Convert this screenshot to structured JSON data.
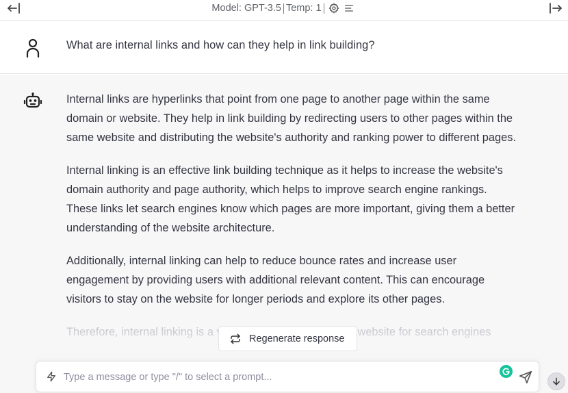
{
  "topbar": {
    "model_label": "Model: GPT-3.5",
    "temp_label": "Temp: 1",
    "icons": [
      "arrow-left-bar-icon",
      "gear-icon",
      "menu-icon",
      "arrow-right-bar-icon"
    ]
  },
  "user_message": {
    "text": "What are internal links and how can they help in link building?",
    "avatar_icon": "user-icon"
  },
  "assistant_message": {
    "avatar_icon": "robot-icon",
    "paragraphs": [
      "Internal links are hyperlinks that point from one page to another page within the same domain or website. They help in link building by redirecting users to other pages within the same website and distributing the website's authority and ranking power to different pages.",
      "Internal linking is an effective link building technique as it helps to increase the website's domain authority and page authority, which helps to improve search engine rankings. These links let search engines know which pages are more important, giving them a better understanding of the website architecture.",
      "Additionally, internal linking can help to reduce bounce rates and increase user engagement by providing users with additional relevant content. This can encourage visitors to stay on the website for longer periods and explore its other pages.",
      "Therefore, internal linking is a valuable tool in optimizing a website for search engines"
    ]
  },
  "regenerate": {
    "label": "Regenerate response",
    "icon": "refresh-icon"
  },
  "composer": {
    "placeholder": "Type a message or type \"/\" to select a prompt...",
    "value": "",
    "icons": [
      "bolt-icon",
      "grammarly-icon",
      "send-icon"
    ]
  },
  "scroll": {
    "icon": "arrow-down-icon"
  },
  "colors": {
    "assistant_bg": "#f7f7f8",
    "grammarly": "#15c39a"
  }
}
